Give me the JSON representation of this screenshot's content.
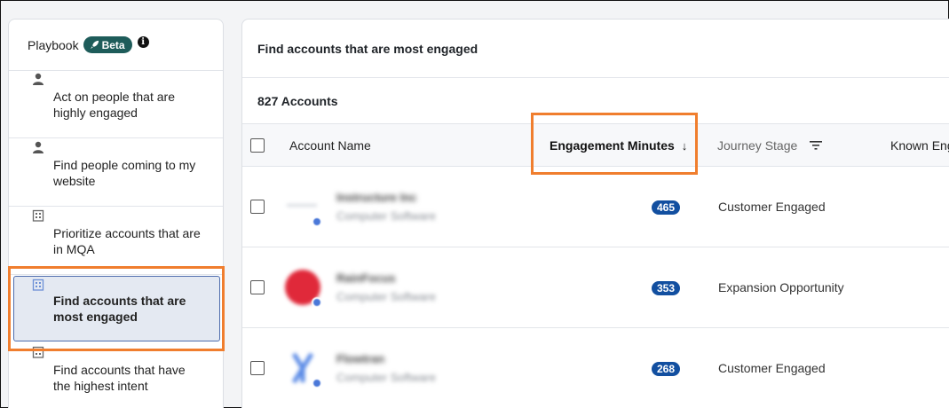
{
  "sidebar": {
    "title": "Playbook",
    "beta_label": "Beta",
    "info_glyph": "i",
    "items": [
      {
        "label": "Act on people that are highly engaged",
        "icon": "person-icon"
      },
      {
        "label": "Find people coming to my website",
        "icon": "person-icon"
      },
      {
        "label": "Prioritize accounts that are in MQA",
        "icon": "building-icon"
      },
      {
        "label": "Find accounts that are most engaged",
        "icon": "building-icon",
        "active": true
      },
      {
        "label": "Find accounts that have the highest intent",
        "icon": "building-icon"
      }
    ]
  },
  "main": {
    "title": "Find accounts that are most engaged",
    "account_count": "827 Accounts",
    "columns": {
      "account_name": "Account Name",
      "engagement_minutes": "Engagement Minutes",
      "sort_glyph": "↓",
      "journey_stage": "Journey Stage",
      "known_engaged": "Known Eng"
    },
    "rows": [
      {
        "name": "Instructure Inc",
        "industry": "Computer Software",
        "minutes": "465",
        "stage": "Customer Engaged",
        "logo_color": "#d8dce2"
      },
      {
        "name": "RainFocus",
        "industry": "Computer Software",
        "minutes": "353",
        "stage": "Expansion Opportunity",
        "logo_color": "#e0293a"
      },
      {
        "name": "Flowtran",
        "industry": "Computer Software",
        "minutes": "268",
        "stage": "Customer Engaged",
        "logo_color": "#5b8be6"
      }
    ]
  },
  "colors": {
    "highlight": "#f07e2e",
    "badge": "#124fa0",
    "beta_badge": "#1e5c5a"
  }
}
